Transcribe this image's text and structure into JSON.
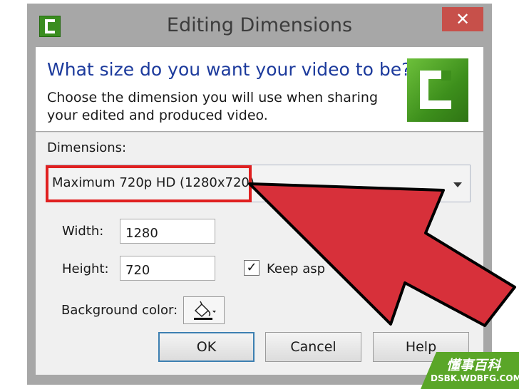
{
  "window": {
    "title": "Editing Dimensions",
    "close_glyph": "✕"
  },
  "header": {
    "title": "What size do you want your video to be?",
    "description": "Choose the dimension you will use when sharing your edited and produced video."
  },
  "form": {
    "dimensions_label": "Dimensions:",
    "dimensions_value": "Maximum 720p HD (1280x720)",
    "width_label": "Width:",
    "width_value": "1280",
    "height_label": "Height:",
    "height_value": "720",
    "keep_aspect_label": "Keep asp",
    "keep_aspect_checked": true,
    "background_color_label": "Background color:"
  },
  "buttons": {
    "ok": "OK",
    "cancel": "Cancel",
    "help": "Help"
  },
  "icons": {
    "app": "camtasia-logo-icon",
    "fill": "paint-bucket-icon",
    "overlay": "red-arrow-annotation"
  },
  "colors": {
    "title_blue": "#1c3a9c",
    "highlight_red": "#e02020",
    "arrow_red": "#d7303a",
    "logo_green": "#3d8f1c",
    "watermark_green": "#5aa628"
  },
  "watermark": {
    "name": "懂事百科",
    "url": "DSBK.WDBFG.COM"
  }
}
